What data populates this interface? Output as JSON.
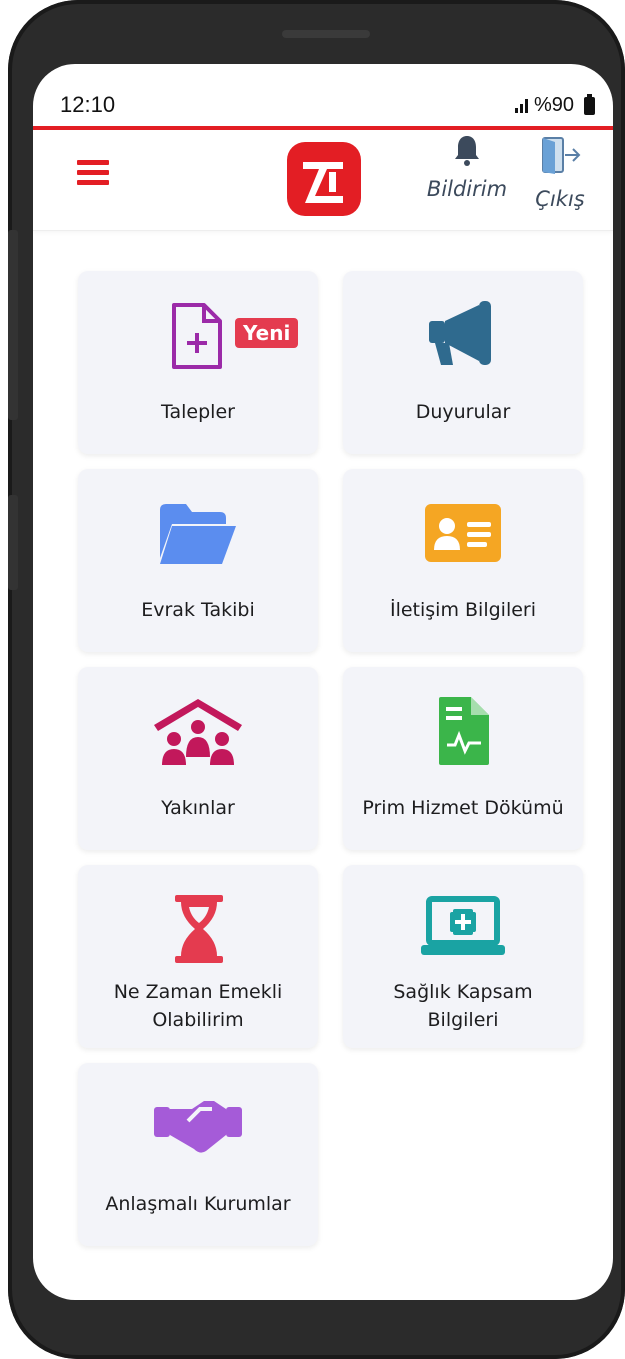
{
  "status_bar": {
    "time": "12:10",
    "battery": "%90"
  },
  "header": {
    "notification_label": "Bildirim",
    "logout_label": "Çıkış",
    "brand_color": "#e31e24"
  },
  "grid": {
    "items": [
      {
        "label": "Talepler",
        "icon": "new-document-icon",
        "badge": "Yeni",
        "color": "#9b2aa8"
      },
      {
        "label": "Duyurular",
        "icon": "megaphone-icon",
        "color": "#2f6a8e"
      },
      {
        "label": "Evrak Takibi",
        "icon": "folder-icon",
        "color": "#5b8def"
      },
      {
        "label": "İletişim Bilgileri",
        "icon": "contact-card-icon",
        "color": "#f5a623"
      },
      {
        "label": "Yakınlar",
        "icon": "family-home-icon",
        "color": "#c2185b"
      },
      {
        "label": "Prim Hizmet Dökümü",
        "icon": "document-chart-icon",
        "color": "#3bb54a"
      },
      {
        "label_line1": "Ne Zaman Emekli",
        "label_line2": "Olabilirim",
        "icon": "hourglass-icon",
        "color": "#e43b4f"
      },
      {
        "label_line1": "Sağlık Kapsam",
        "label_line2": "Bilgileri",
        "icon": "health-monitor-icon",
        "color": "#1aa3a3"
      },
      {
        "label": "Anlaşmalı Kurumlar",
        "icon": "handshake-icon",
        "color": "#a55bd8"
      }
    ]
  }
}
